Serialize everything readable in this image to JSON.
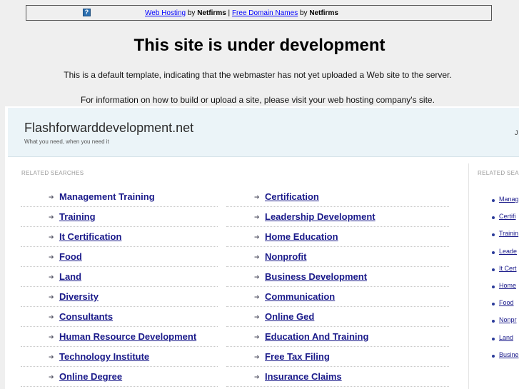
{
  "topbar": {
    "icon": "question-icon",
    "link1": "Web Hosting",
    "by1": " by ",
    "brand1": "Netfirms",
    "sep": " | ",
    "link2": "Free Domain Names",
    "by2": " by ",
    "brand2": "Netfirms"
  },
  "notice": {
    "title": "This site is under development",
    "line1": "This is a default template, indicating that the webmaster has not yet uploaded a Web site to the server.",
    "line2": "For information on how to build or upload a site, please visit your web hosting company's site."
  },
  "site": {
    "title": "Flashforwarddevelopment.net",
    "tagline": "What you need, when you need it",
    "header_right_cut": "J"
  },
  "main": {
    "label": "RELATED SEARCHES",
    "left": [
      {
        "text": "Management Training",
        "underline": false
      },
      {
        "text": "Training",
        "underline": true
      },
      {
        "text": "It Certification",
        "underline": true
      },
      {
        "text": "Food",
        "underline": true
      },
      {
        "text": "Land",
        "underline": true
      },
      {
        "text": "Diversity",
        "underline": true
      },
      {
        "text": "Consultants",
        "underline": true
      },
      {
        "text": "Human Resource Development",
        "underline": true
      },
      {
        "text": "Technology Institute",
        "underline": true
      },
      {
        "text": "Online Degree",
        "underline": true
      }
    ],
    "right": [
      {
        "text": "Certification",
        "underline": true
      },
      {
        "text": "Leadership Development",
        "underline": true
      },
      {
        "text": "Home Education",
        "underline": true
      },
      {
        "text": "Nonprofit",
        "underline": true
      },
      {
        "text": "Business Development",
        "underline": true
      },
      {
        "text": "Communication",
        "underline": true
      },
      {
        "text": "Online Ged",
        "underline": true
      },
      {
        "text": "Education And Training",
        "underline": true
      },
      {
        "text": "Free Tax Filing",
        "underline": true
      },
      {
        "text": "Insurance Claims",
        "underline": true
      }
    ]
  },
  "side": {
    "label": "RELATED SEA",
    "items": [
      "Manag",
      "Certifi",
      "Trainin",
      "Leade",
      "It Cert",
      "Home",
      "Food",
      "Nonpr",
      "Land",
      "Busine"
    ]
  }
}
